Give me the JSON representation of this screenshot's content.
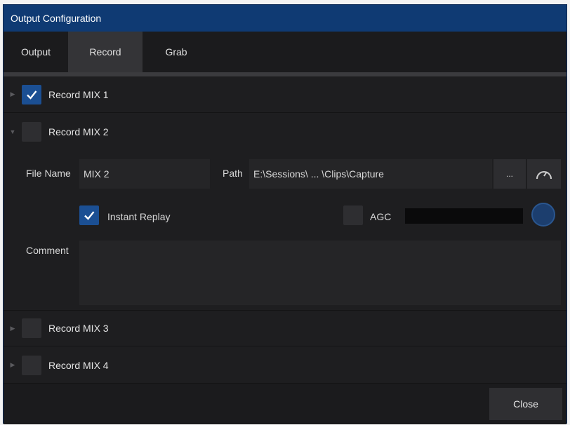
{
  "window": {
    "title": "Output Configuration"
  },
  "tabs": [
    {
      "label": "Output"
    },
    {
      "label": "Record"
    },
    {
      "label": "Grab"
    }
  ],
  "records": [
    {
      "label": "Record MIX 1",
      "checked": true
    },
    {
      "label": "Record MIX 2",
      "checked": false
    },
    {
      "label": "Record MIX 3",
      "checked": false
    },
    {
      "label": "Record MIX 4",
      "checked": false
    }
  ],
  "detail": {
    "file_name_label": "File Name",
    "file_name_value": "MIX 2",
    "path_label": "Path",
    "path_value": "E:\\Sessions\\ ... \\Clips\\Capture",
    "browse_label": "...",
    "instant_replay_label": "Instant Replay",
    "instant_replay_checked": true,
    "agc_label": "AGC",
    "agc_checked": false,
    "comment_label": "Comment",
    "comment_value": ""
  },
  "footer": {
    "close_label": "Close"
  },
  "colors": {
    "accent": "#1b4f93",
    "title_bar": "#0f3a73",
    "window_bg": "#1e1e20"
  }
}
